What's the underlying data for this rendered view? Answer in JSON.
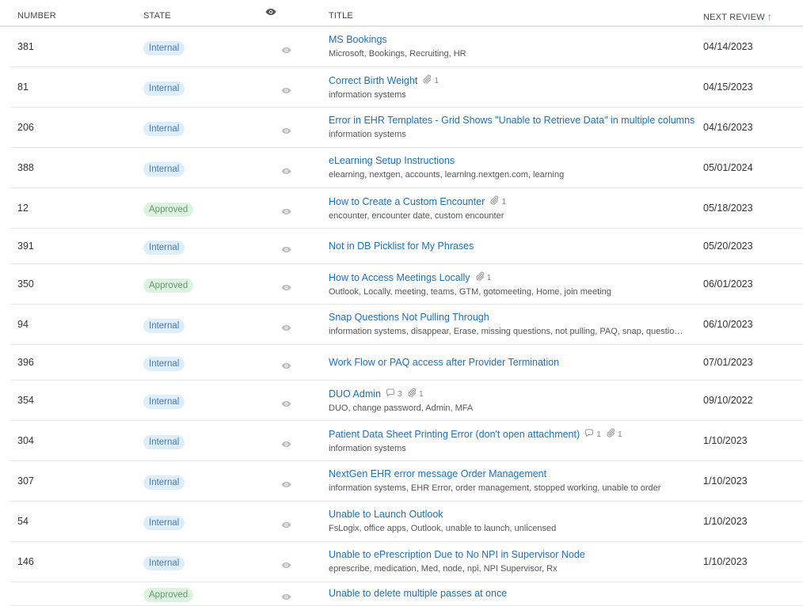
{
  "header": {
    "number": "NUMBER",
    "state": "STATE",
    "title": "TITLE",
    "next_review": "NEXT REVIEW"
  },
  "rows": [
    {
      "number": "381",
      "state": "Internal",
      "title": "MS Bookings",
      "tags": "Microsoft, Bookings, Recruiting, HR",
      "comments": "",
      "attachments": "",
      "next_review": "04/14/2023"
    },
    {
      "number": "81",
      "state": "Internal",
      "title": "Correct Birth Weight",
      "tags": "information systems",
      "comments": "",
      "attachments": "1",
      "next_review": "04/15/2023"
    },
    {
      "number": "206",
      "state": "Internal",
      "title": "Error in EHR Templates - Grid Shows \"Unable to Retrieve Data\" in multiple columns",
      "tags": "information systems",
      "comments": "",
      "attachments": "",
      "next_review": "04/16/2023"
    },
    {
      "number": "388",
      "state": "Internal",
      "title": "eLearning Setup Instructions",
      "tags": "elearning, nextgen, accounts, learning.nextgen.com, learning",
      "comments": "",
      "attachments": "",
      "next_review": "05/01/2024"
    },
    {
      "number": "12",
      "state": "Approved",
      "title": "How to Create a Custom Encounter",
      "tags": "encounter, encounter date, custom encounter",
      "comments": "",
      "attachments": "1",
      "next_review": "05/18/2023"
    },
    {
      "number": "391",
      "state": "Internal",
      "title": "Not in DB Picklist for My Phrases",
      "tags": "",
      "comments": "",
      "attachments": "",
      "next_review": "05/20/2023"
    },
    {
      "number": "350",
      "state": "Approved",
      "title": "How to Access Meetings Locally",
      "tags": "Outlook, Locally, meeting, teams, GTM, gotomeeting, Home, join meeting",
      "comments": "",
      "attachments": "1",
      "next_review": "06/01/2023"
    },
    {
      "number": "94",
      "state": "Internal",
      "title": "Snap Questions Not Pulling Through",
      "tags": "information systems, disappear, Erase, missing questions, not pulling, PAQ, snap, questio…",
      "comments": "",
      "attachments": "",
      "next_review": "06/10/2023"
    },
    {
      "number": "396",
      "state": "Internal",
      "title": "Work Flow or PAQ access after Provider Termination",
      "tags": "",
      "comments": "",
      "attachments": "",
      "next_review": "07/01/2023"
    },
    {
      "number": "354",
      "state": "Internal",
      "title": "DUO Admin",
      "tags": "DUO, change password, Admin, MFA",
      "comments": "3",
      "attachments": "1",
      "next_review": "09/10/2022"
    },
    {
      "number": "304",
      "state": "Internal",
      "title": "Patient Data Sheet Printing Error (don't open attachment)",
      "tags": "information systems",
      "comments": "1",
      "attachments": "1",
      "next_review": "1/10/2023"
    },
    {
      "number": "307",
      "state": "Internal",
      "title": "NextGen EHR error message Order Management",
      "tags": "information systems, EHR Error, order management, stopped working, unable to order",
      "comments": "",
      "attachments": "",
      "next_review": "1/10/2023"
    },
    {
      "number": "54",
      "state": "Internal",
      "title": "Unable to Launch Outlook",
      "tags": "FsLogix, office apps, Outlook, unable to launch, unlicensed",
      "comments": "",
      "attachments": "",
      "next_review": "1/10/2023"
    },
    {
      "number": "146",
      "state": "Internal",
      "title": "Unable to ePrescription Due to No NPI in Supervisor Node",
      "tags": "eprescribe, medication, Med, node, npi, NPI Supervisor, Rx",
      "comments": "",
      "attachments": "",
      "next_review": "1/10/2023"
    },
    {
      "number": "",
      "state": "Approved",
      "title": "Unable to delete multiple passes at once",
      "tags": "",
      "comments": "",
      "attachments": "",
      "next_review": ""
    }
  ],
  "colors": {
    "link": "#1f6fb5",
    "internal_bg": "#ddeefa",
    "approved_bg": "#def2e2",
    "sort_accent": "#1a9bd7"
  }
}
